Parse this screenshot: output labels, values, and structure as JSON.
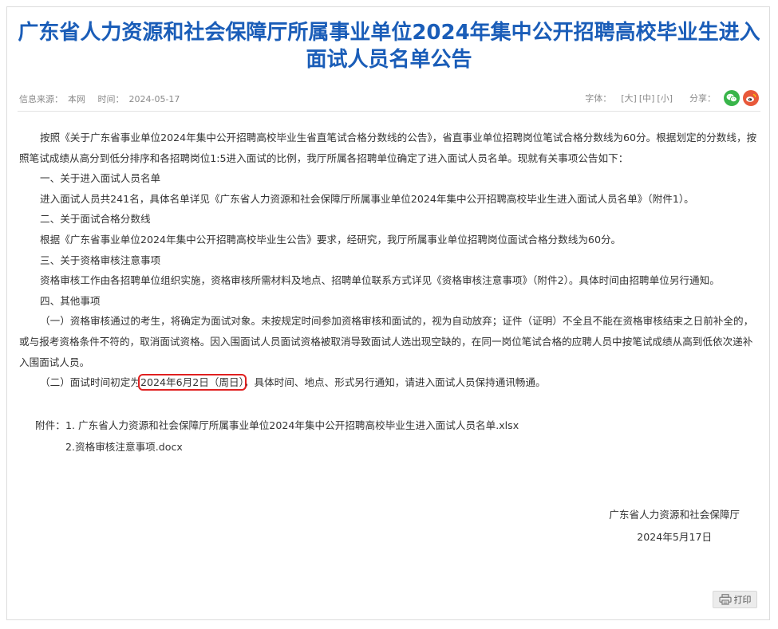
{
  "article": {
    "title": "广东省人力资源和社会保障厅所属事业单位2024年集中公开招聘高校毕业生进入面试人员名单公告",
    "meta": {
      "source_label": "信息来源：",
      "source_value": "本网",
      "time_label": "时间：",
      "time_value": "2024-05-17",
      "font_label": "字体：",
      "font_large": "[大]",
      "font_medium": "[中]",
      "font_small": "[小]",
      "share_label": "分享："
    },
    "paragraphs": [
      "按照《关于广东省事业单位2024年集中公开招聘高校毕业生省直笔试合格分数线的公告》，省直事业单位招聘岗位笔试合格分数线为60分。根据划定的分数线，按照笔试成绩从高分到低分排序和各招聘岗位1:5进入面试的比例，我厅所属各招聘单位确定了进入面试人员名单。现就有关事项公告如下：",
      "一、关于进入面试人员名单",
      "进入面试人员共241名，具体名单详见《广东省人力资源和社会保障厅所属事业单位2024年集中公开招聘高校毕业生进入面试人员名单》（附件1）。",
      "二、关于面试合格分数线",
      "根据《广东省事业单位2024年集中公开招聘高校毕业生公告》要求，经研究，我厅所属事业单位招聘岗位面试合格分数线为60分。",
      "三、关于资格审核注意事项",
      "资格审核工作由各招聘单位组织实施，资格审核所需材料及地点、招聘单位联系方式详见《资格审核注意事项》（附件2）。具体时间由招聘单位另行通知。",
      "四、其他事项",
      "（一）资格审核通过的考生，将确定为面试对象。未按规定时间参加资格审核和面试的，视为自动放弃；证件（证明）不全且不能在资格审核结束之日前补全的，或与报考资格条件不符的，取消面试资格。因入围面试人员面试资格被取消导致面试人选出现空缺的，在同一岗位笔试合格的应聘人员中按笔试成绩从高到低依次递补入围面试人员。"
    ],
    "interview": {
      "prefix": "（二）面试时间初定为",
      "date": "2024年6月2日（周日）",
      "suffix": "，具体时间、地点、形式另行通知，请进入面试人员保持通讯畅通。"
    },
    "attachments": {
      "label": "附件：",
      "items": [
        "1. 广东省人力资源和社会保障厅所属事业单位2024年集中公开招聘高校毕业生进入面试人员名单.xlsx",
        "2.资格审核注意事项.docx"
      ]
    },
    "signature": {
      "org": "广东省人力资源和社会保障厅",
      "date": "2024年5月17日"
    },
    "print_label": "打印"
  },
  "colors": {
    "title": "#1a5db8",
    "highlight_box": "#e02020",
    "wechat": "#39b54a",
    "weibo": "#e8593b"
  }
}
